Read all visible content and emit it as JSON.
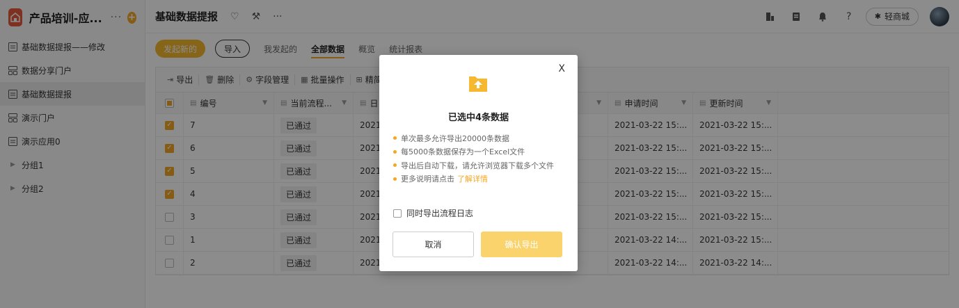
{
  "app": {
    "title": "产品培训-应...",
    "more_label": "···",
    "add_label": "+"
  },
  "sidebar": {
    "items": [
      {
        "label": "基础数据提报——修改",
        "icon": "form-icon"
      },
      {
        "label": "数据分享门户",
        "icon": "portal-icon"
      },
      {
        "label": "基础数据提报",
        "icon": "form-icon",
        "active": true
      },
      {
        "label": "演示门户",
        "icon": "portal-icon"
      },
      {
        "label": "演示应用0",
        "icon": "form-icon"
      },
      {
        "label": "分组1",
        "icon": "caret-right-icon"
      },
      {
        "label": "分组2",
        "icon": "caret-right-icon"
      }
    ]
  },
  "topbar": {
    "page_title": "基础数据提报",
    "mall_label": "轻商城"
  },
  "tabs": {
    "new_label": "发起新的",
    "import_label": "导入",
    "items": [
      "我发起的",
      "全部数据",
      "概览",
      "统计报表"
    ],
    "active": "全部数据"
  },
  "toolbar": {
    "export": "导出",
    "delete": "删除",
    "fields": "字段管理",
    "batch": "批量操作",
    "filter": "精简"
  },
  "table": {
    "headers": {
      "num": "编号",
      "status": "当前流程...",
      "date": "日",
      "apply": "申请时间",
      "update": "更新时间"
    },
    "rows": [
      {
        "num": "7",
        "status": "已通过",
        "date": "2021",
        "apply": "2021-03-22 15:...",
        "update": "2021-03-22 15:...",
        "checked": true
      },
      {
        "num": "6",
        "status": "已通过",
        "date": "2021",
        "apply": "2021-03-22 15:...",
        "update": "2021-03-22 15:...",
        "checked": true
      },
      {
        "num": "5",
        "status": "已通过",
        "date": "2021",
        "apply": "2021-03-22 15:...",
        "update": "2021-03-22 15:...",
        "checked": true
      },
      {
        "num": "4",
        "status": "已通过",
        "date": "2021",
        "apply": "2021-03-22 15:...",
        "update": "2021-03-22 15:...",
        "checked": true
      },
      {
        "num": "3",
        "status": "已通过",
        "date": "2021",
        "apply": "2021-03-22 15:...",
        "update": "2021-03-22 15:...",
        "checked": false
      },
      {
        "num": "1",
        "status": "已通过",
        "date": "2021",
        "apply": "2021-03-22 14:...",
        "update": "2021-03-22 15:...",
        "checked": false
      },
      {
        "num": "2",
        "status": "已通过",
        "date": "2021",
        "apply": "2021-03-22 14:...",
        "update": "2021-03-22 14:...",
        "checked": false
      }
    ]
  },
  "dialog": {
    "close_label": "X",
    "title": "已选中4条数据",
    "notes": [
      "单次最多允许导出20000条数据",
      "每5000条数据保存为一个Excel文件",
      "导出后自动下载，请允许浏览器下载多个文件",
      "更多说明请点击"
    ],
    "link_label": "了解详情",
    "checkbox_label": "同时导出流程日志",
    "cancel_label": "取消",
    "confirm_label": "确认导出"
  },
  "colors": {
    "accent": "#f5a623",
    "logo": "#e5593d",
    "confirm_disabled": "#fbd36d"
  }
}
